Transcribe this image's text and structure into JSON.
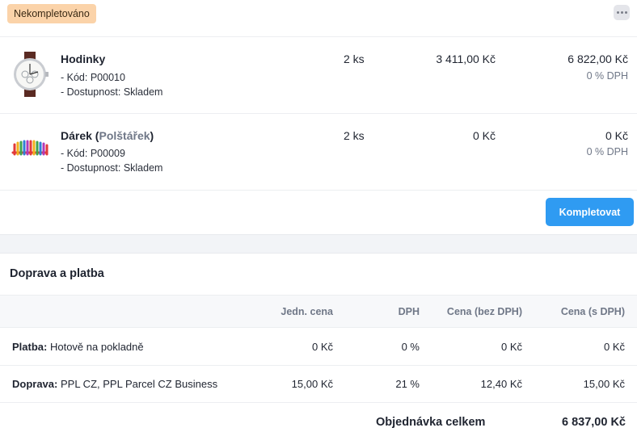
{
  "status_badge": "Nekompletováno",
  "items": [
    {
      "name": "Hodinky",
      "variant_open": "",
      "variant": "",
      "variant_close": "",
      "code": "- Kód: P00010",
      "availability": "- Dostupnost: Skladem",
      "qty": "2 ks",
      "unit_price": "3 411,00 Kč",
      "total": "6 822,00 Kč",
      "vat": "0 % DPH",
      "thumb_icon": "watch-icon"
    },
    {
      "name": "Dárek",
      "variant_open": " (",
      "variant": "Polštářek",
      "variant_close": ")",
      "code": "- Kód: P00009",
      "availability": "- Dostupnost: Skladem",
      "qty": "2 ks",
      "unit_price": "0 Kč",
      "total": "0 Kč",
      "vat": "0 % DPH",
      "thumb_icon": "pillow-icon"
    }
  ],
  "complete_button": "Kompletovat",
  "shipping": {
    "title": "Doprava a platba",
    "headers": [
      "Jedn. cena",
      "DPH",
      "Cena (bez DPH)",
      "Cena (s DPH)"
    ],
    "rows": [
      {
        "label": "Platba:",
        "value": "Hotově na pokladně",
        "unit": "0 Kč",
        "vat": "0 %",
        "net": "0 Kč",
        "gross": "0 Kč"
      },
      {
        "label": "Doprava:",
        "value": "PPL CZ, PPL Parcel CZ Business",
        "unit": "15,00 Kč",
        "vat": "21 %",
        "net": "12,40 Kč",
        "gross": "15,00 Kč"
      }
    ]
  },
  "order_total_label": "Objednávka celkem",
  "order_total_value": "6 837,00 Kč"
}
